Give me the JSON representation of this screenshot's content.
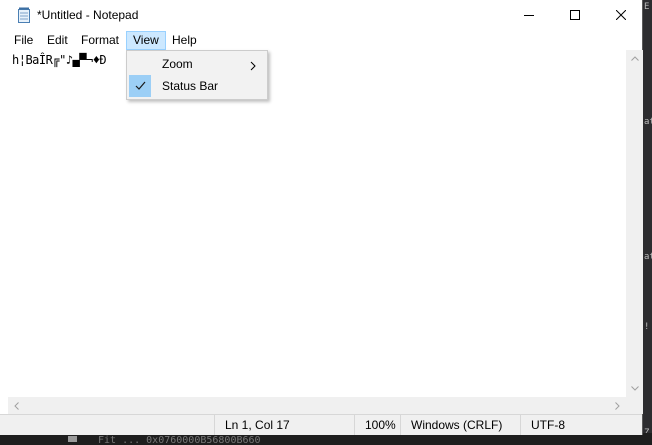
{
  "window": {
    "title": "*Untitled - Notepad"
  },
  "menu": {
    "file": "File",
    "edit": "Edit",
    "format": "Format",
    "view": "View",
    "help": "Help"
  },
  "view_menu": {
    "zoom": "Zoom",
    "status_bar": "Status Bar",
    "status_bar_checked": true
  },
  "editor": {
    "content": "h¦BaÎR╔\"♪▄▀¬♦Ð"
  },
  "status": {
    "position": "Ln 1, Col 17",
    "zoom": "100%",
    "line_ending": "Windows (CRLF)",
    "encoding": "UTF-8"
  },
  "background": {
    "right_fragments": [
      "E",
      "at",
      "at",
      "!",
      "Z"
    ],
    "bottom_text": "Fit      ... 0x0760000B56800B660"
  },
  "icons": {
    "app": "notepad-icon",
    "minimize": "minimize-icon",
    "maximize": "maximize-icon",
    "close": "close-icon",
    "submenu": "chevron-right-icon",
    "check": "check-icon"
  }
}
